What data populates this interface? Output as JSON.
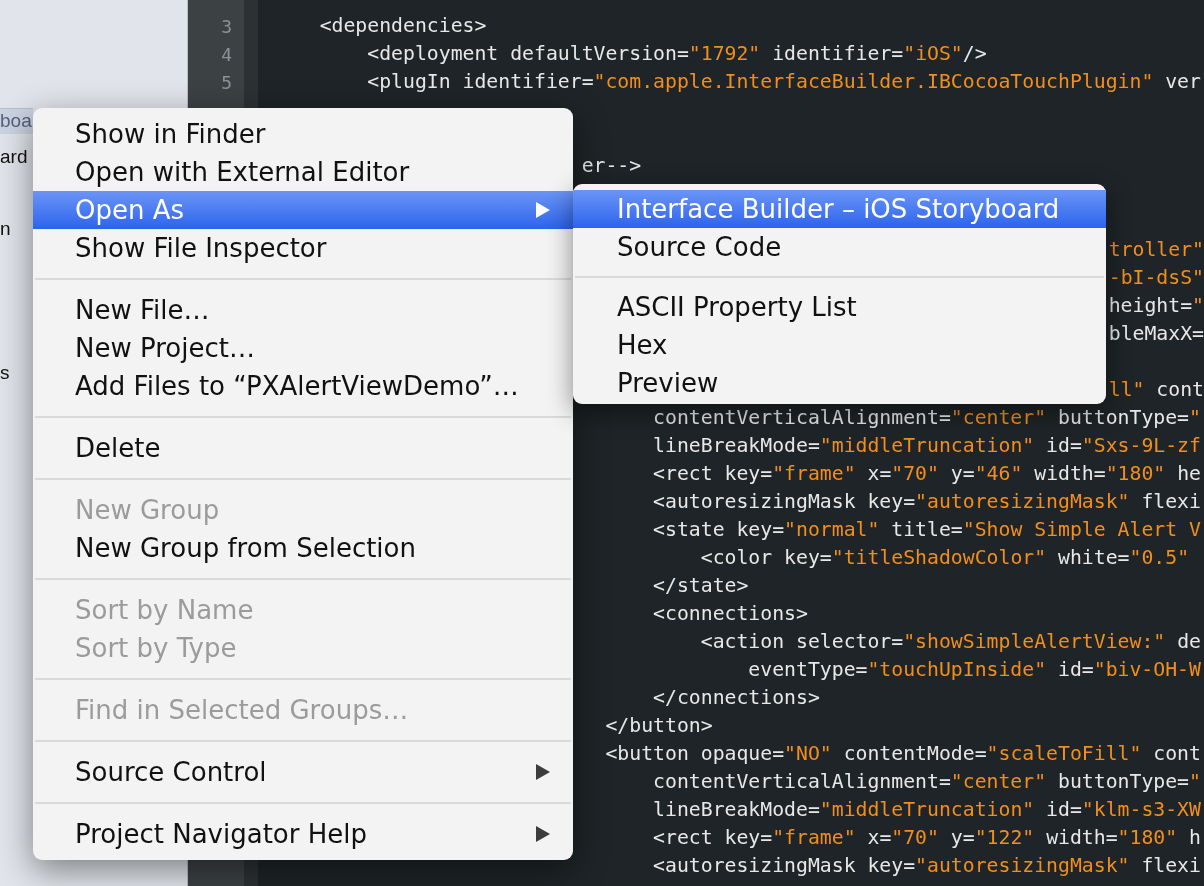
{
  "sidebar": {
    "items": [
      {
        "label": "boa",
        "selected": true
      },
      {
        "label": "ard",
        "selected": false
      },
      {
        "label": "n",
        "selected": false
      },
      {
        "label": "s",
        "selected": false
      }
    ]
  },
  "gutter": {
    "line_numbers": [
      "3",
      "4",
      "5"
    ]
  },
  "code": {
    "lines": [
      "<dependencies>",
      "<deployment defaultVersion=\"1792\" identifier=\"iOS\"/>",
      "<plugIn identifier=\"com.apple.InterfaceBuilder.IBCocoaTouchPlugin\" ver",
      "er-->",
      "troller\"",
      "-bI-dsS\"",
      "height=\"",
      "bleMaxX=",
      "ll\" cont",
      "contentVerticalAlignment=\"center\" buttonType=\"",
      "lineBreakMode=\"middleTruncation\" id=\"Sxs-9L-zf",
      "<rect key=\"frame\" x=\"70\" y=\"46\" width=\"180\" he",
      "<autoresizingMask key=\"autoresizingMask\" flexi",
      "<state key=\"normal\" title=\"Show Simple Alert V",
      "<color key=\"titleShadowColor\" white=\"0.5\"",
      "</state>",
      "<connections>",
      "<action selector=\"showSimpleAlertView:\" de",
      "eventType=\"touchUpInside\" id=\"biv-OH-W",
      "</connections>",
      "</button>",
      "<button opaque=\"NO\" contentMode=\"scaleToFill\" cont",
      "contentVerticalAlignment=\"center\" buttonType=\"",
      "lineBreakMode=\"middleTruncation\" id=\"klm-s3-XW",
      "<rect key=\"frame\" x=\"70\" y=\"122\" width=\"180\" h",
      "<autoresizingMask key=\"autoresizingMask\" flexi"
    ]
  },
  "context_menu": {
    "items": [
      {
        "kind": "item",
        "label": "Show in Finder",
        "selected": false,
        "disabled": false
      },
      {
        "kind": "item",
        "label": "Open with External Editor",
        "selected": false,
        "disabled": false
      },
      {
        "kind": "submenu",
        "label": "Open As",
        "selected": true,
        "disabled": false
      },
      {
        "kind": "item",
        "label": "Show File Inspector",
        "selected": false,
        "disabled": false
      },
      {
        "kind": "separator"
      },
      {
        "kind": "item",
        "label": "New File…",
        "selected": false,
        "disabled": false
      },
      {
        "kind": "item",
        "label": "New Project…",
        "selected": false,
        "disabled": false
      },
      {
        "kind": "item",
        "label": "Add Files to “PXAlertViewDemo”…",
        "selected": false,
        "disabled": false
      },
      {
        "kind": "separator"
      },
      {
        "kind": "item",
        "label": "Delete",
        "selected": false,
        "disabled": false
      },
      {
        "kind": "separator"
      },
      {
        "kind": "item",
        "label": "New Group",
        "selected": false,
        "disabled": true
      },
      {
        "kind": "item",
        "label": "New Group from Selection",
        "selected": false,
        "disabled": false
      },
      {
        "kind": "separator"
      },
      {
        "kind": "item",
        "label": "Sort by Name",
        "selected": false,
        "disabled": true
      },
      {
        "kind": "item",
        "label": "Sort by Type",
        "selected": false,
        "disabled": true
      },
      {
        "kind": "separator"
      },
      {
        "kind": "item",
        "label": "Find in Selected Groups…",
        "selected": false,
        "disabled": true
      },
      {
        "kind": "separator"
      },
      {
        "kind": "submenu",
        "label": "Source Control",
        "selected": false,
        "disabled": false
      },
      {
        "kind": "separator"
      },
      {
        "kind": "submenu",
        "label": "Project Navigator Help",
        "selected": false,
        "disabled": false
      }
    ]
  },
  "submenu": {
    "items": [
      {
        "kind": "item",
        "label": "Interface Builder – iOS Storyboard",
        "selected": true,
        "disabled": false
      },
      {
        "kind": "item",
        "label": "Source Code",
        "selected": false,
        "disabled": false
      },
      {
        "kind": "separator"
      },
      {
        "kind": "item",
        "label": "ASCII Property List",
        "selected": false,
        "disabled": false
      },
      {
        "kind": "item",
        "label": "Hex",
        "selected": false,
        "disabled": false
      },
      {
        "kind": "item",
        "label": "Preview",
        "selected": false,
        "disabled": false
      }
    ]
  }
}
